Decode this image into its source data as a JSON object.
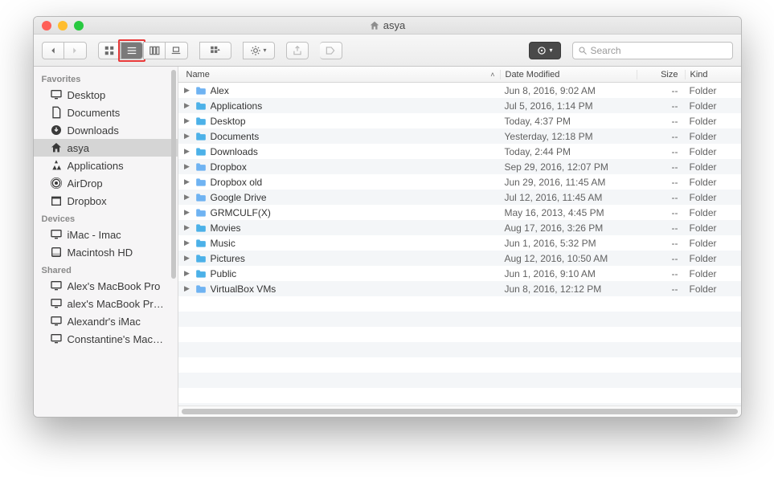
{
  "window": {
    "title": "asya"
  },
  "search": {
    "placeholder": "Search"
  },
  "columns": {
    "name": "Name",
    "date": "Date Modified",
    "size": "Size",
    "kind": "Kind"
  },
  "sidebar": {
    "sections": [
      {
        "heading": "Favorites",
        "items": [
          {
            "label": "Desktop",
            "icon": "monitor"
          },
          {
            "label": "Documents",
            "icon": "doc"
          },
          {
            "label": "Downloads",
            "icon": "download"
          },
          {
            "label": "asya",
            "icon": "home",
            "selected": true
          },
          {
            "label": "Applications",
            "icon": "apps"
          },
          {
            "label": "AirDrop",
            "icon": "airdrop"
          },
          {
            "label": "Dropbox",
            "icon": "box"
          }
        ]
      },
      {
        "heading": "Devices",
        "items": [
          {
            "label": "iMac - Imac",
            "icon": "monitor"
          },
          {
            "label": "Macintosh HD",
            "icon": "disk"
          }
        ]
      },
      {
        "heading": "Shared",
        "items": [
          {
            "label": "Alex's MacBook Pro",
            "icon": "monitor"
          },
          {
            "label": "alex's MacBook Pr…",
            "icon": "monitor"
          },
          {
            "label": "Alexandr's iMac",
            "icon": "monitor"
          },
          {
            "label": "Constantine's Mac…",
            "icon": "monitor"
          }
        ]
      }
    ]
  },
  "files": [
    {
      "name": "Alex",
      "date": "Jun 8, 2016, 9:02 AM",
      "size": "--",
      "kind": "Folder",
      "color": "#6fb3f2"
    },
    {
      "name": "Applications",
      "date": "Jul 5, 2016, 1:14 PM",
      "size": "--",
      "kind": "Folder",
      "color": "#4cb1e8"
    },
    {
      "name": "Desktop",
      "date": "Today, 4:37 PM",
      "size": "--",
      "kind": "Folder",
      "color": "#4cb1e8"
    },
    {
      "name": "Documents",
      "date": "Yesterday, 12:18 PM",
      "size": "--",
      "kind": "Folder",
      "color": "#4cb1e8"
    },
    {
      "name": "Downloads",
      "date": "Today, 2:44 PM",
      "size": "--",
      "kind": "Folder",
      "color": "#4cb1e8"
    },
    {
      "name": "Dropbox",
      "date": "Sep 29, 2016, 12:07 PM",
      "size": "--",
      "kind": "Folder",
      "color": "#6fb3f2"
    },
    {
      "name": "Dropbox old",
      "date": "Jun 29, 2016, 11:45 AM",
      "size": "--",
      "kind": "Folder",
      "color": "#6fb3f2"
    },
    {
      "name": "Google Drive",
      "date": "Jul 12, 2016, 11:45 AM",
      "size": "--",
      "kind": "Folder",
      "color": "#6fb3f2"
    },
    {
      "name": "GRMCULF(X)",
      "date": "May 16, 2013, 4:45 PM",
      "size": "--",
      "kind": "Folder",
      "color": "#6fb3f2"
    },
    {
      "name": "Movies",
      "date": "Aug 17, 2016, 3:26 PM",
      "size": "--",
      "kind": "Folder",
      "color": "#4cb1e8"
    },
    {
      "name": "Music",
      "date": "Jun 1, 2016, 5:32 PM",
      "size": "--",
      "kind": "Folder",
      "color": "#4cb1e8"
    },
    {
      "name": "Pictures",
      "date": "Aug 12, 2016, 10:50 AM",
      "size": "--",
      "kind": "Folder",
      "color": "#4cb1e8"
    },
    {
      "name": "Public",
      "date": "Jun 1, 2016, 9:10 AM",
      "size": "--",
      "kind": "Folder",
      "color": "#4cb1e8"
    },
    {
      "name": "VirtualBox VMs",
      "date": "Jun 8, 2016, 12:12 PM",
      "size": "--",
      "kind": "Folder",
      "color": "#6fb3f2"
    }
  ]
}
